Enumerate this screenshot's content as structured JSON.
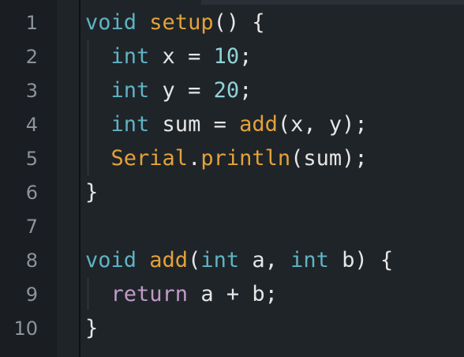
{
  "editor": {
    "lines": [
      {
        "number": "1",
        "tokens": [
          {
            "t": "void",
            "c": "kw"
          },
          {
            "t": " ",
            "c": "pl"
          },
          {
            "t": "setup",
            "c": "fn"
          },
          {
            "t": "() {",
            "c": "pl"
          }
        ]
      },
      {
        "number": "2",
        "tokens": [
          {
            "t": "  ",
            "c": "pl"
          },
          {
            "t": "int",
            "c": "kw"
          },
          {
            "t": " x = ",
            "c": "pl"
          },
          {
            "t": "10",
            "c": "num"
          },
          {
            "t": ";",
            "c": "pl"
          }
        ]
      },
      {
        "number": "3",
        "tokens": [
          {
            "t": "  ",
            "c": "pl"
          },
          {
            "t": "int",
            "c": "kw"
          },
          {
            "t": " y = ",
            "c": "pl"
          },
          {
            "t": "20",
            "c": "num"
          },
          {
            "t": ";",
            "c": "pl"
          }
        ]
      },
      {
        "number": "4",
        "tokens": [
          {
            "t": "  ",
            "c": "pl"
          },
          {
            "t": "int",
            "c": "kw"
          },
          {
            "t": " sum = ",
            "c": "pl"
          },
          {
            "t": "add",
            "c": "fn"
          },
          {
            "t": "(x, y);",
            "c": "pl"
          }
        ]
      },
      {
        "number": "5",
        "tokens": [
          {
            "t": "  ",
            "c": "pl"
          },
          {
            "t": "Serial",
            "c": "fn"
          },
          {
            "t": ".",
            "c": "pl"
          },
          {
            "t": "println",
            "c": "fn"
          },
          {
            "t": "(sum);",
            "c": "pl"
          }
        ]
      },
      {
        "number": "6",
        "tokens": [
          {
            "t": "}",
            "c": "pl"
          }
        ]
      },
      {
        "number": "7",
        "tokens": []
      },
      {
        "number": "8",
        "tokens": [
          {
            "t": "void",
            "c": "kw"
          },
          {
            "t": " ",
            "c": "pl"
          },
          {
            "t": "add",
            "c": "fn"
          },
          {
            "t": "(",
            "c": "pl"
          },
          {
            "t": "int",
            "c": "kw"
          },
          {
            "t": " a, ",
            "c": "pl"
          },
          {
            "t": "int",
            "c": "kw"
          },
          {
            "t": " b) {",
            "c": "pl"
          }
        ]
      },
      {
        "number": "9",
        "tokens": [
          {
            "t": "  ",
            "c": "pl"
          },
          {
            "t": "return",
            "c": "ret"
          },
          {
            "t": " a + b;",
            "c": "pl"
          }
        ]
      },
      {
        "number": "10",
        "tokens": [
          {
            "t": "}",
            "c": "pl"
          }
        ]
      }
    ]
  },
  "colors": {
    "background": "#1f2428",
    "gutter": "#1a1d21",
    "keyword": "#5fb3c4",
    "function": "#e3a23b",
    "number": "#8fd3d6",
    "return_keyword": "#c39ac9",
    "plain": "#e6e6e6",
    "line_number": "#8c949c"
  }
}
